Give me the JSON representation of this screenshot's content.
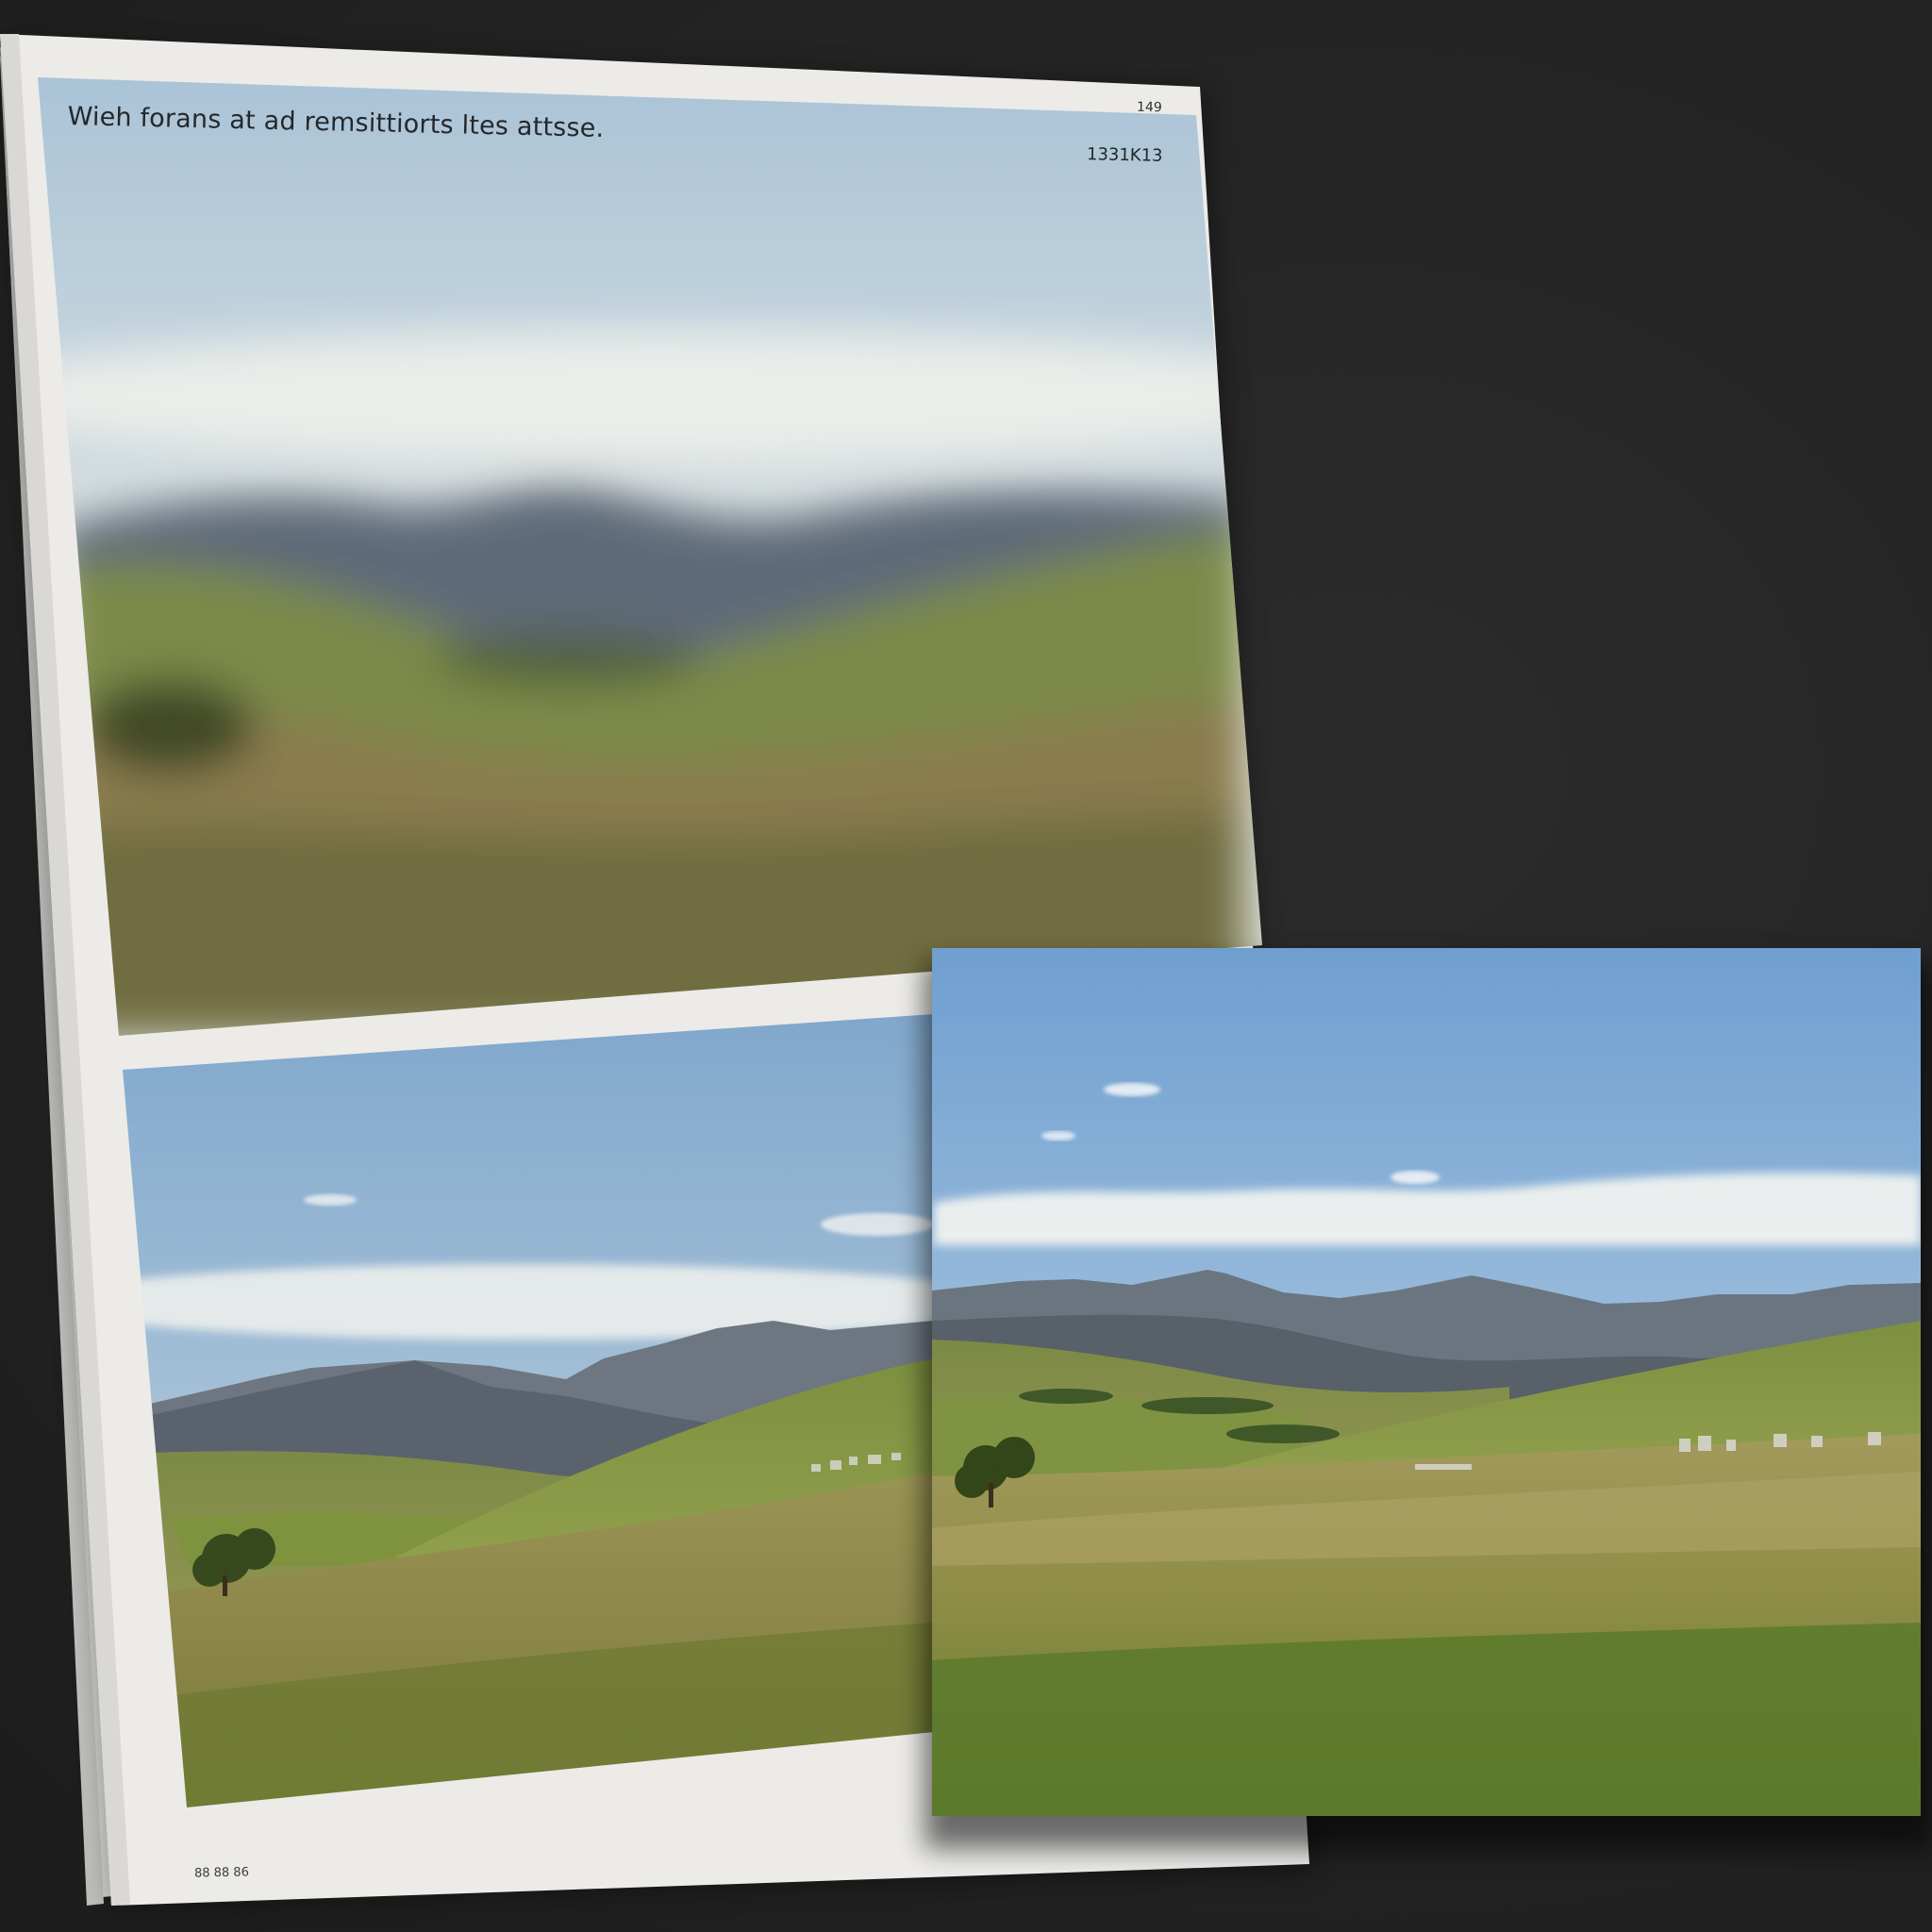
{
  "magazine": {
    "caption": "Wieh forans at ad remsittiorts ltes attsse.",
    "page_number": "149",
    "code": "1331K13",
    "footer": "88 88 86"
  },
  "colors": {
    "background": "#222222",
    "paper": "#ececea",
    "sky": "#8fb3d4",
    "grass": "#8a8a3e",
    "mountain": "#5c6670"
  }
}
